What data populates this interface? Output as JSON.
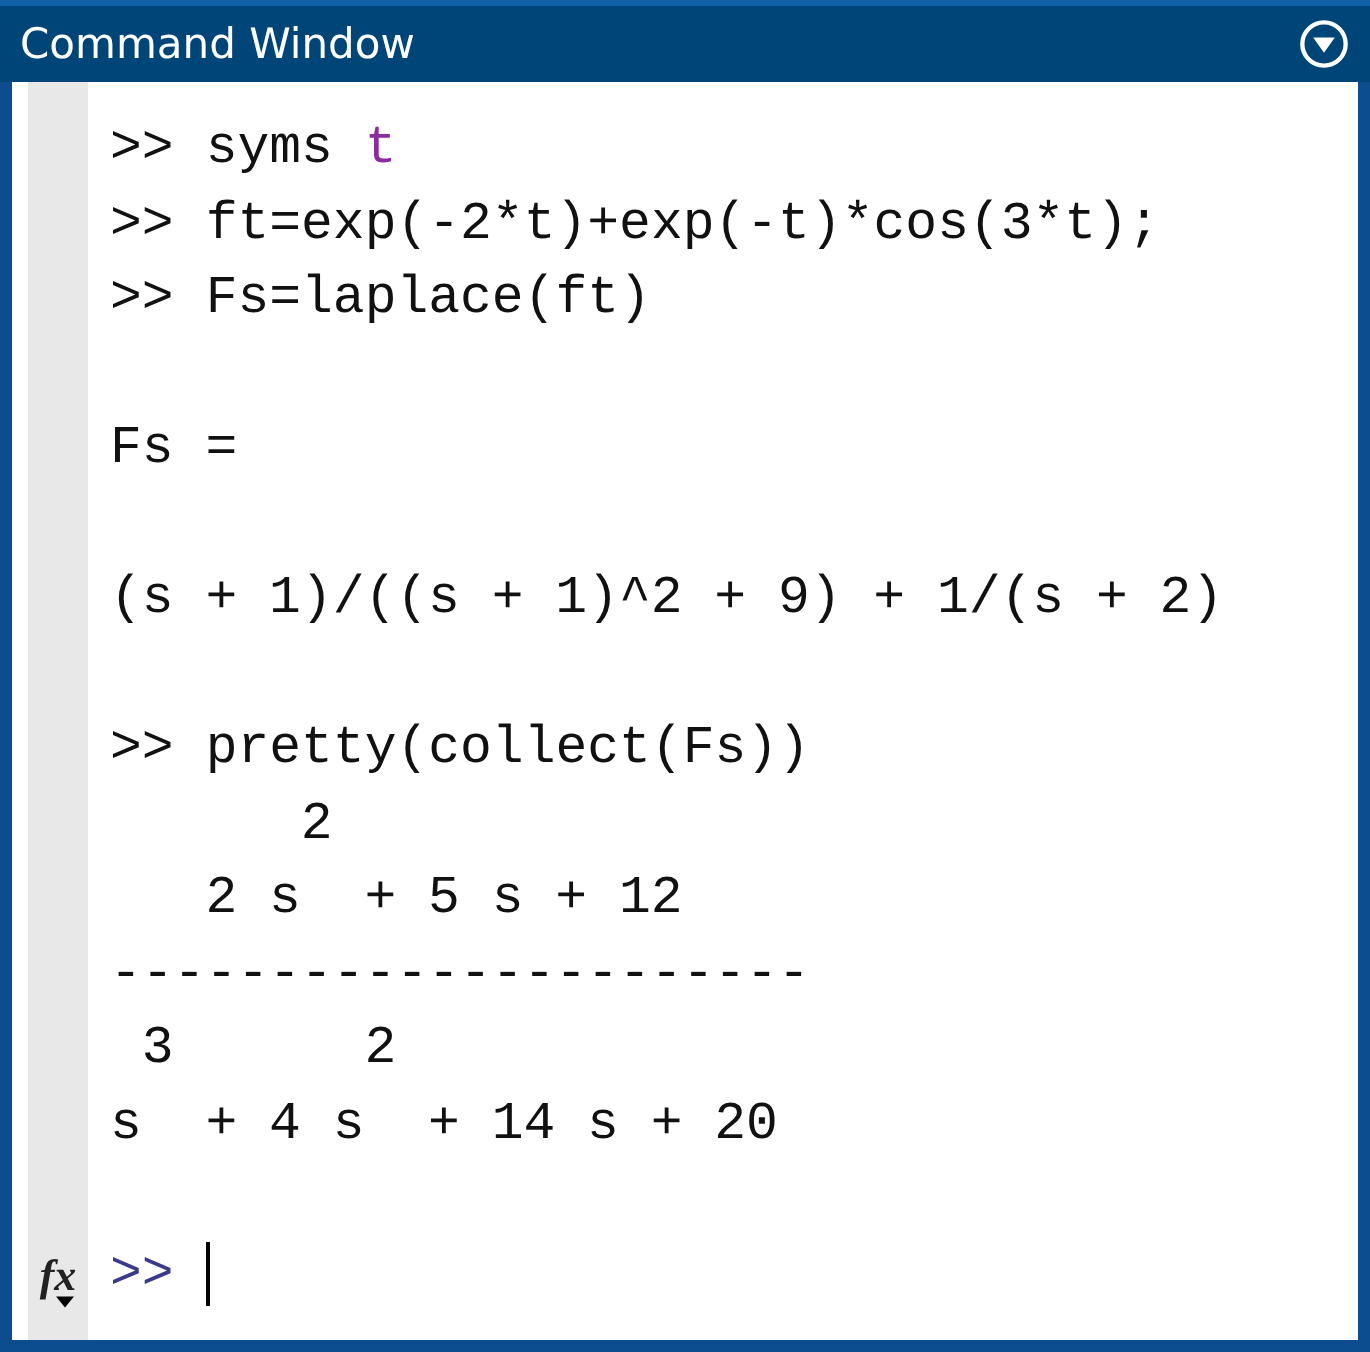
{
  "window": {
    "title": "Command Window"
  },
  "lines": [
    {
      "kind": "command",
      "prompt": ">>",
      "tokens": [
        {
          "text": "syms ",
          "kind": "code"
        },
        {
          "text": "t",
          "kind": "string"
        }
      ]
    },
    {
      "kind": "command",
      "prompt": ">>",
      "tokens": [
        {
          "text": "ft=exp(-2*t)+exp(-t)*cos(3*t);",
          "kind": "code"
        }
      ]
    },
    {
      "kind": "command",
      "prompt": ">>",
      "tokens": [
        {
          "text": "Fs=laplace(ft)",
          "kind": "code"
        }
      ]
    },
    {
      "kind": "blank"
    },
    {
      "kind": "output",
      "text": "Fs ="
    },
    {
      "kind": "blank"
    },
    {
      "kind": "output",
      "text": "(s + 1)/((s + 1)^2 + 9) + 1/(s + 2)"
    },
    {
      "kind": "blank"
    },
    {
      "kind": "command",
      "prompt": ">>",
      "tokens": [
        {
          "text": "pretty(collect(Fs))",
          "kind": "code"
        }
      ]
    },
    {
      "kind": "output",
      "text": "      2"
    },
    {
      "kind": "output",
      "text": "   2 s  + 5 s + 12"
    },
    {
      "kind": "output",
      "text": "----------------------"
    },
    {
      "kind": "output",
      "text": " 3      2"
    },
    {
      "kind": "output",
      "text": "s  + 4 s  + 14 s + 20"
    },
    {
      "kind": "blank"
    }
  ],
  "input_line": {
    "function_button": "fx",
    "prompt": ">>"
  }
}
